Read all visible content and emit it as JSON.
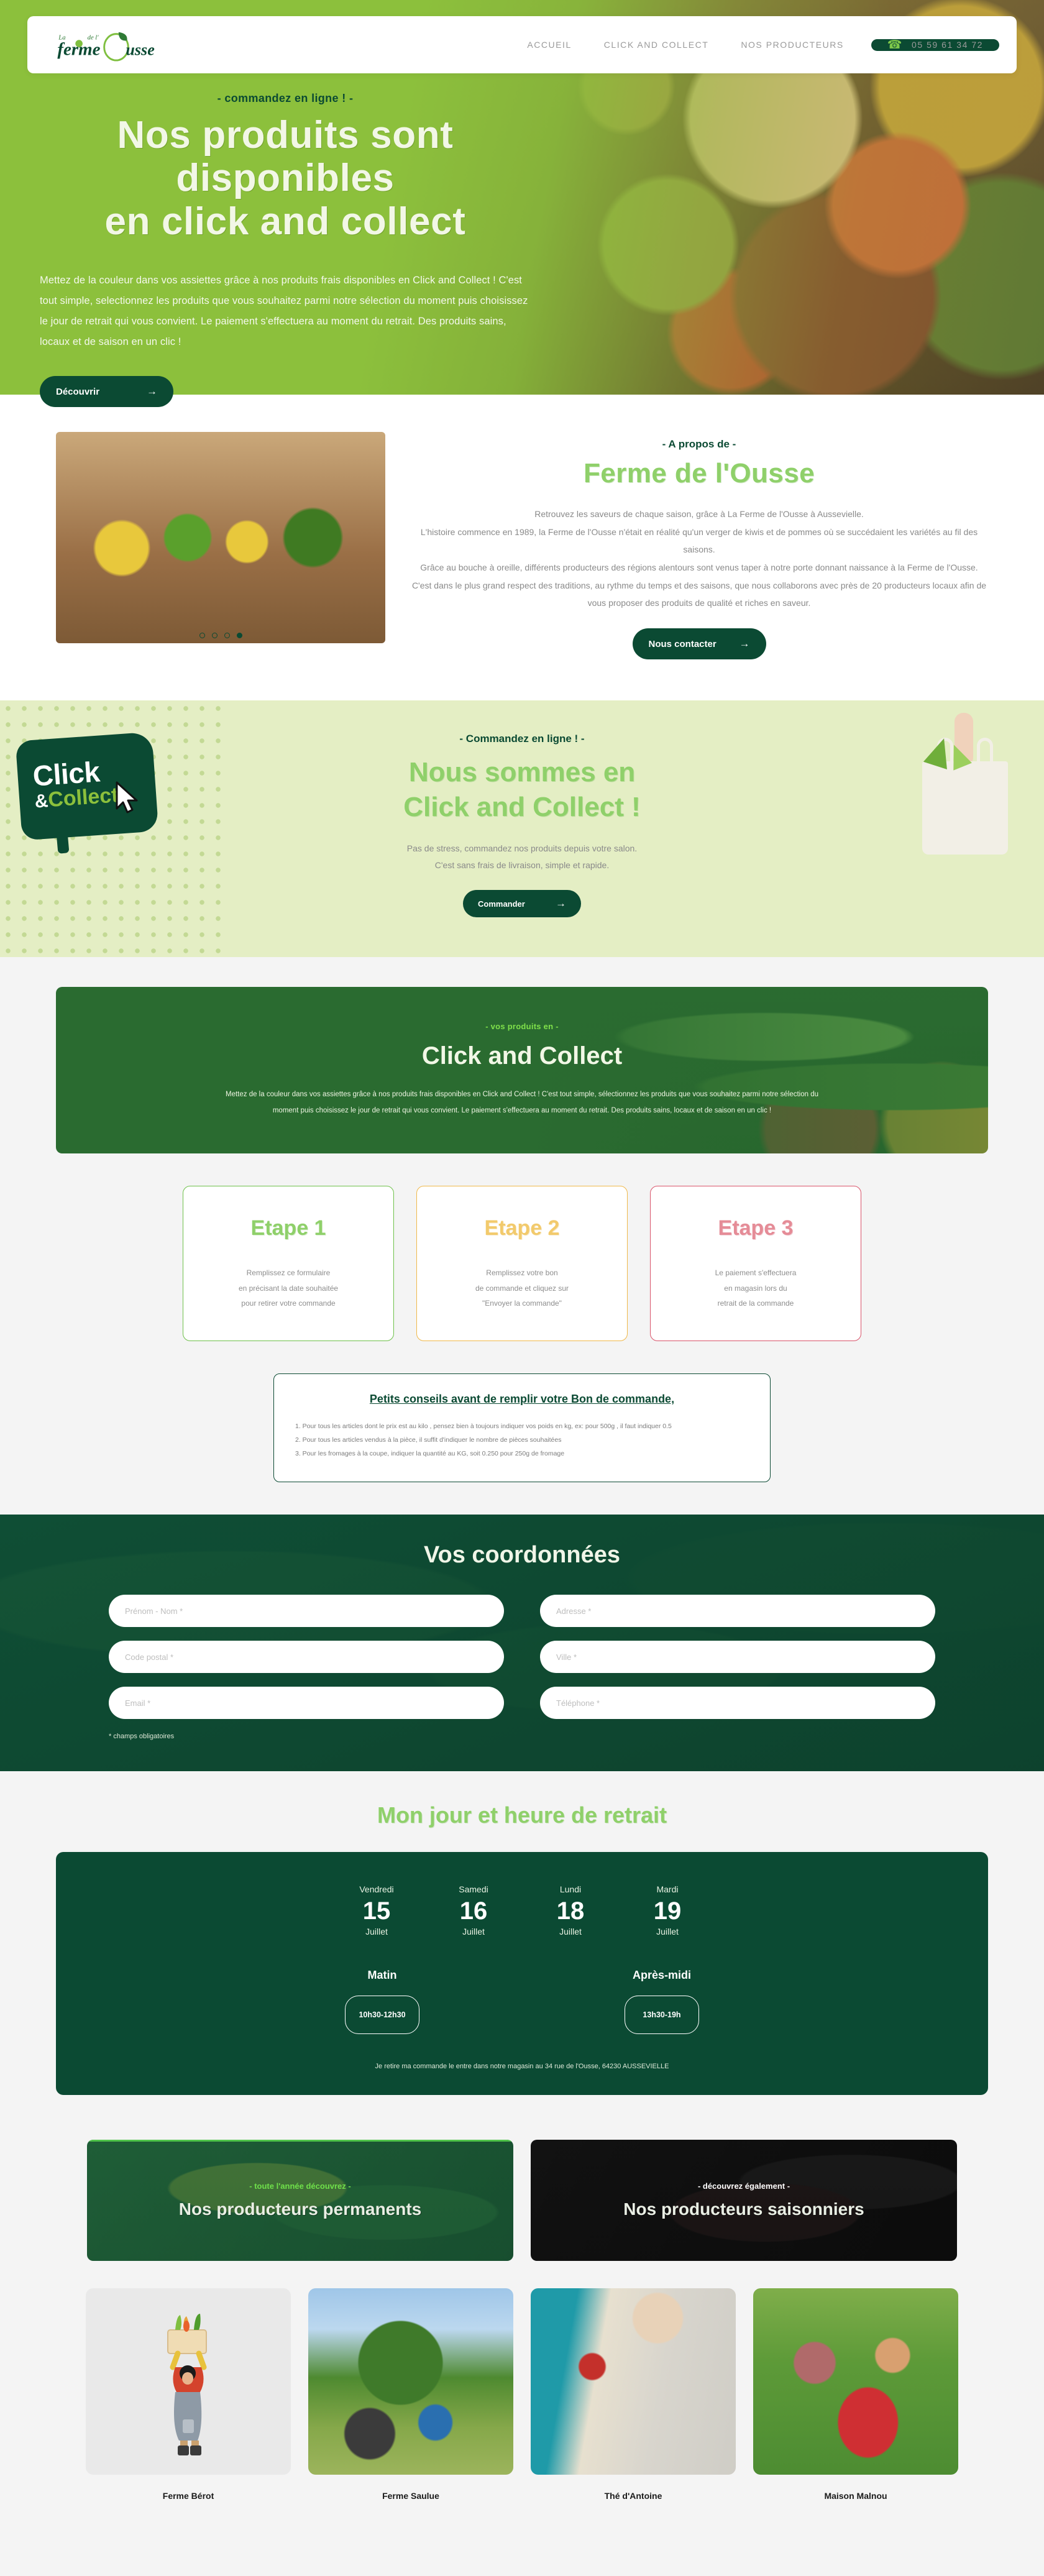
{
  "header": {
    "logo_alt": "la ferme de l'Ousse",
    "nav": [
      {
        "label": "ACCUEIL"
      },
      {
        "label": "CLICK AND COLLECT"
      },
      {
        "label": "NOS PRODUCTEURS"
      }
    ],
    "phone": "05 59 61 34 72"
  },
  "hero": {
    "eyebrow": "- commandez en ligne ! -",
    "title_line1": "Nos produits sont disponibles",
    "title_line2": "en click and collect",
    "body": "Mettez de la couleur dans vos assiettes grâce à nos produits frais disponibles en Click and Collect ! C'est tout simple, selectionnez les produits que vous souhaitez parmi notre sélection du moment puis choisissez le jour de retrait qui vous convient. Le paiement s'effectuera au moment du retrait. Des produits sains, locaux et de saison en un clic !",
    "cta": "Découvrir",
    "cta_arrow": "→"
  },
  "about": {
    "eyebrow": "- A propos de -",
    "title": "Ferme de l'Ousse",
    "paragraphs": [
      "Retrouvez les saveurs de chaque saison, grâce à La Ferme de l'Ousse à Aussevielle.",
      "L'histoire commence en 1989, la Ferme de l'Ousse n'était en réalité qu'un verger de kiwis et de pommes où se succédaient les variétés au fil des saisons.",
      "Grâce au bouche à oreille, différents producteurs des régions alentours sont venus taper à notre porte donnant naissance à la Ferme de l'Ousse.",
      "C'est dans le plus grand respect des traditions, au rythme du temps et des saisons, que nous collaborons avec près de 20 producteurs locaux afin de vous proposer des produits de qualité et riches en saveur."
    ],
    "cta": "Nous contacter",
    "cta_arrow": "→",
    "carousel_dots": 4,
    "carousel_active": 4
  },
  "band": {
    "badge_line1": "Click",
    "badge_amp": "&",
    "badge_line2": "Collect",
    "eyebrow": "- Commandez en ligne ! -",
    "title_line1": "Nous sommes en",
    "title_line2": "Click and Collect !",
    "body_line1": "Pas de stress, commandez nos produits depuis votre salon.",
    "body_line2": "C'est sans frais de livraison, simple et rapide.",
    "cta": "Commander",
    "cta_arrow": "→"
  },
  "cc_box": {
    "eyebrow": "- vos produits en -",
    "title": "Click and Collect",
    "body": "Mettez de la couleur dans vos assiettes grâce à nos produits frais disponibles en Click and Collect ! C'est tout simple, sélectionnez les produits que vous souhaitez parmi notre sélection du moment puis choisissez le jour de retrait qui vous convient. Le paiement s'effectuera au moment du retrait. Des produits sains, locaux et de saison en un clic !"
  },
  "etapes": [
    {
      "title": "Etape 1",
      "color": "#8fd06a",
      "lines": [
        "Remplissez ce formulaire",
        "en précisant la date souhaitée",
        "pour retirer votre commande"
      ]
    },
    {
      "title": "Etape 2",
      "color": "#f2ca6c",
      "lines": [
        "Remplissez votre bon",
        "de commande et cliquez sur",
        "\"Envoyer la commande\""
      ]
    },
    {
      "title": "Etape 3",
      "color": "#e58c97",
      "lines": [
        "Le paiement s'effectuera",
        "en magasin lors du",
        "retrait de la commande"
      ]
    }
  ],
  "conseils": {
    "title": "Petits conseils avant de remplir votre Bon de commande,",
    "items": [
      "1. Pour tous les articles dont le prix est au kilo , pensez bien à toujours indiquer vos poids en kg, ex: pour 500g , il faut indiquer 0.5",
      "2. Pour tous les articles vendus à la pièce, il suffit d'indiquer le nombre de pièces souhaitées",
      "3. Pour les fromages à la coupe, indiquer la quantité au KG, soit 0.250 pour 250g de fromage"
    ]
  },
  "coord": {
    "title": "Vos coordonnées",
    "fields": [
      {
        "name": "prenom-nom",
        "placeholder": "Prénom - Nom *",
        "value": ""
      },
      {
        "name": "adresse",
        "placeholder": "Adresse *",
        "value": ""
      },
      {
        "name": "code-postal",
        "placeholder": "Code postal *",
        "value": ""
      },
      {
        "name": "ville",
        "placeholder": "Ville *",
        "value": ""
      },
      {
        "name": "email",
        "placeholder": "Email *",
        "value": ""
      },
      {
        "name": "telephone",
        "placeholder": "Téléphone *",
        "value": ""
      }
    ],
    "required_note": "* champs obligatoires"
  },
  "retrait": {
    "title": "Mon jour et heure de retrait",
    "days": [
      {
        "weekday": "Vendredi",
        "number": "15",
        "month": "Juillet"
      },
      {
        "weekday": "Samedi",
        "number": "16",
        "month": "Juillet"
      },
      {
        "weekday": "Lundi",
        "number": "18",
        "month": "Juillet"
      },
      {
        "weekday": "Mardi",
        "number": "19",
        "month": "Juillet"
      }
    ],
    "slots": [
      {
        "label": "Matin",
        "time": "10h30-12h30"
      },
      {
        "label": "Après-midi",
        "time": "13h30-19h"
      }
    ],
    "note": "Je retire ma commande le entre dans notre magasin au 34 rue de l'Ousse, 64230 AUSSEVIELLE"
  },
  "producteurs_banners": [
    {
      "eyebrow": "- toute l'année découvrez -",
      "title": "Nos producteurs permanents",
      "theme": "green"
    },
    {
      "eyebrow": "- découvrez également -",
      "title": "Nos producteurs saisonniers",
      "theme": "dark"
    }
  ],
  "producteurs": [
    {
      "name": "Ferme Bérot"
    },
    {
      "name": "Ferme Saulue"
    },
    {
      "name": "Thé d'Antoine"
    },
    {
      "name": "Maison Malnou"
    }
  ],
  "colors": {
    "brand_dark_green": "#0b4a33",
    "brand_light_green": "#8cc03c",
    "accent_green": "#8fd06a",
    "amber": "#f2ca6c",
    "rose": "#e58c97",
    "page_bg": "#f4f4f4"
  }
}
